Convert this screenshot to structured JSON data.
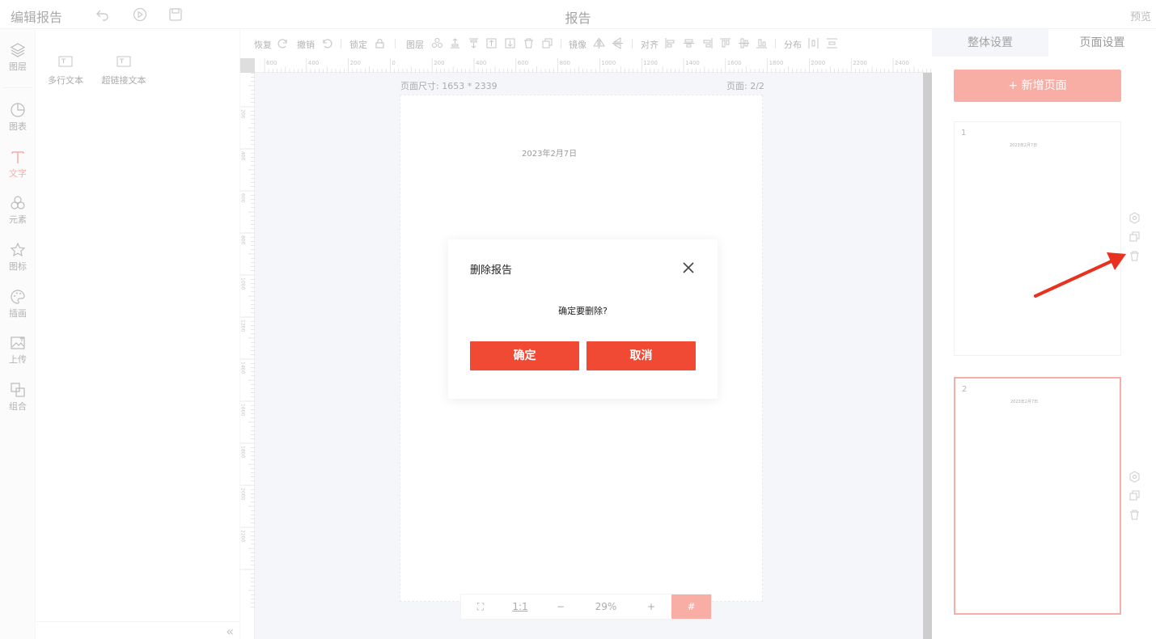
{
  "topbar": {
    "app_name": "编辑报告",
    "title": "报告",
    "preview": "预览",
    "icons": [
      "undo-icon",
      "play-icon",
      "save-icon"
    ]
  },
  "iconbar": {
    "items": [
      {
        "label": "图层",
        "icon": "layers-icon"
      },
      {
        "label": "图表",
        "icon": "chart-icon"
      },
      {
        "label": "文字",
        "icon": "text-icon",
        "active": true
      },
      {
        "label": "元素",
        "icon": "elements-icon"
      },
      {
        "label": "图标",
        "icon": "star-icon"
      },
      {
        "label": "插画",
        "icon": "palette-icon"
      },
      {
        "label": "上传",
        "icon": "upload-image-icon"
      },
      {
        "label": "组合",
        "icon": "group-icon"
      }
    ]
  },
  "leftpanel": {
    "items": [
      {
        "label": "多行文本",
        "icon": "textbox-icon"
      },
      {
        "label": "超链接文本",
        "icon": "link-textbox-icon"
      }
    ],
    "collapse": "«"
  },
  "toolbar": {
    "redo_label": "恢复",
    "undo_label": "撤销",
    "lock_label": "锁定",
    "layer_label": "图层",
    "mirror_label": "镜像",
    "align_label": "对齐",
    "distribute_label": "分布"
  },
  "ruler": {
    "h_labels": [
      "600",
      "400",
      "200",
      "0",
      "200",
      "400",
      "600",
      "800",
      "1000",
      "1200",
      "1400",
      "1600",
      "1800",
      "2000",
      "2200",
      "2400"
    ],
    "v_labels": [
      "200",
      "400",
      "600",
      "800",
      "1000",
      "1200",
      "1400",
      "1600",
      "1800",
      "2000",
      "2200"
    ]
  },
  "canvas": {
    "page_size": "页面尺寸: 1653 * 2339",
    "page_count": "页面: 2/2",
    "page_date": "2023年2月7日",
    "zoom": {
      "fit": "⛶",
      "one_to_one": "1:1",
      "minus": "−",
      "percent": "29%",
      "plus": "+",
      "grid": "#"
    }
  },
  "rightpanel": {
    "tabs": [
      "整体设置",
      "页面设置"
    ],
    "add_page": "+ 新增页面",
    "thumbs": [
      {
        "num": "1",
        "date": "2023年2月7日"
      },
      {
        "num": "2",
        "date": "2023年2月7日"
      }
    ]
  },
  "dialog": {
    "title": "删除报告",
    "message": "确定要删除?",
    "confirm": "确定",
    "cancel": "取消"
  },
  "colors": {
    "accent": "#f05a4a",
    "button": "#f04a35",
    "annotation_arrow": "#e8321f"
  }
}
